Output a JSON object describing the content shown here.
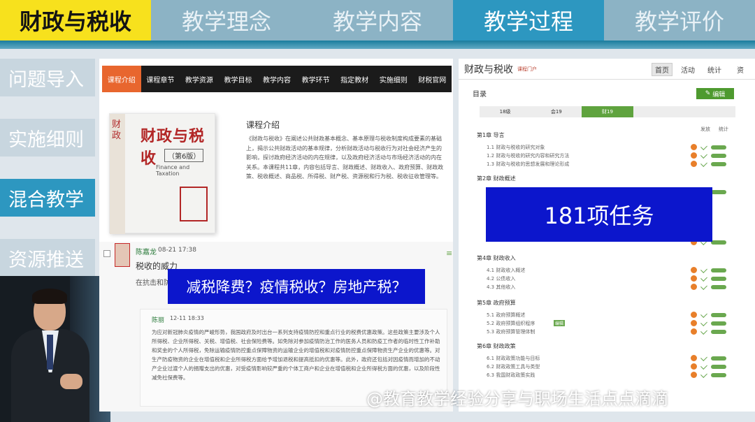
{
  "top_tabs": [
    {
      "label": "财政与税收"
    },
    {
      "label": "教学理念"
    },
    {
      "label": "教学内容"
    },
    {
      "label": "教学过程"
    },
    {
      "label": "教学评价"
    }
  ],
  "left_nav": [
    {
      "label": "问题导入"
    },
    {
      "label": "实施细则"
    },
    {
      "label": "混合教学"
    },
    {
      "label": "资源推送"
    }
  ],
  "course_nav": [
    "课程介绍",
    "课程章节",
    "教学资源",
    "教学目标",
    "教学内容",
    "教学环节",
    "指定教材",
    "实施细则",
    "财税官网"
  ],
  "book": {
    "spine": "财政",
    "title": "财政与税收",
    "edition": "（第6版）",
    "english": "Finance and Taxation"
  },
  "intro": {
    "title": "课程介绍",
    "text": "《财政与税收》在阐述公共财政基本概念、基本原理与税收制度构成要素的基础上，揭示公共财政活动的基本规律，分析财政活动与税收行为对社会经济产生的影响，探讨政府经济活动的内在规律，以及政府经济活动与市场经济活动的内在关系。本课程共11章，内容包括导言、财政概述、财政收入、政府预算、财政政策、税收概述、商品税、所得税、财产税、资源税和行为税、税收征收管理等。"
  },
  "post": {
    "author": "陈嘉龙",
    "time": "08-21 17:38",
    "title": "税收的威力",
    "subtitle": "在抗击和防范",
    "reply_author": "陈丽",
    "reply_time": "12-11 18:33",
    "reply_text": "为应对新冠肺炎疫情的严峻形势，我国政府及时出台一系列支持疫情防控和重点行业的税费优惠政策。这些政策主要涉及个人所得税、企业所得税、关税、增值税、社会保险费等。如免除对参加疫情防治工作的医务人员和防疫工作者的临时性工作补助和奖金的个人所得税，免除运输疫情防控重点保障物资的运输企业的增值税和对疫情防控重点保障物资生产企业的优惠等。对生产防疫物资的企业在增值税和企业所得税方面给予增加退税和提高抵扣的优惠等。此外，政府还包括对因疫情而增加的不动产企业过渡个人的捐赠支出的优惠，对受疫情影响较严重的个体工商户和企业在增值税和企业所得税方面的优惠，以及阶段性减免社保费等。"
  },
  "banner_questions": "减税降费？疫情税收？房地产税？",
  "right": {
    "title": "财政与税收",
    "subtitle": "课程门户",
    "nav": [
      "首页",
      "活动",
      "统计",
      "资"
    ],
    "directory": "目录",
    "edit": "编辑",
    "semesters": [
      "18级",
      "会19",
      "财19"
    ],
    "col_headers": [
      "发放",
      "统计"
    ],
    "chapters": [
      {
        "title": "第1章 导言",
        "lessons": [
          "1.1 财政与税收的研究对象",
          "1.2 财政与税收的研究内容和研究方法",
          "1.3 财政与税收的思想发展和理论形成"
        ]
      },
      {
        "title": "第2章 财政概述",
        "lessons": []
      },
      {
        "title": "第4章 财政收入",
        "lessons": [
          "4.1 财政收入概述",
          "4.2 公债收入",
          "4.3 其他收入"
        ]
      },
      {
        "title": "第5章 政府预算",
        "lessons": [
          "5.1 政府预算概述",
          "5.2 政府预算组织程序",
          "5.3 政府预算管理体制"
        ]
      },
      {
        "title": "第6章 财政政策",
        "lessons": [
          "6.1 财政政策功能与目标",
          "6.2 财政政策工具与类型",
          "6.3 我国财政政策实践"
        ]
      }
    ],
    "tag": "编辑"
  },
  "banner_tasks": "181项任务",
  "watermark": "@教育教学经验分享与职场生活点点滴滴"
}
